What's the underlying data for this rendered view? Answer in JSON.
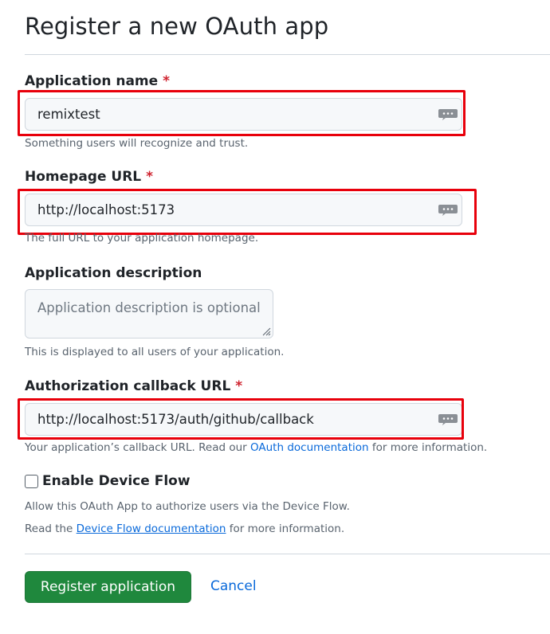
{
  "page": {
    "title": "Register a new OAuth app"
  },
  "fields": {
    "app_name": {
      "label": "Application name",
      "required_mark": "*",
      "value": "remixtest",
      "hint": "Something users will recognize and trust."
    },
    "homepage_url": {
      "label": "Homepage URL",
      "required_mark": "*",
      "value": "http://localhost:5173",
      "hint": "The full URL to your application homepage."
    },
    "description": {
      "label": "Application description",
      "placeholder": "Application description is optional",
      "hint": "This is displayed to all users of your application."
    },
    "callback_url": {
      "label": "Authorization callback URL",
      "required_mark": "*",
      "value": "http://localhost:5173/auth/github/callback",
      "hint_pre": "Your application’s callback URL. Read our ",
      "hint_link": "OAuth documentation",
      "hint_post": " for more information."
    }
  },
  "device_flow": {
    "label": "Enable Device Flow",
    "checked": false,
    "line1": "Allow this OAuth App to authorize users via the Device Flow.",
    "line2_pre": "Read the ",
    "line2_link": "Device Flow documentation",
    "line2_post": " for more information."
  },
  "actions": {
    "register_label": "Register application",
    "cancel_label": "Cancel"
  },
  "colors": {
    "primary_button": "#1f883d",
    "link": "#0969da",
    "required": "#cf222e",
    "highlight_box": "#e8000b"
  },
  "icons": {
    "input_icon": "password-manager-icon",
    "checkbox": "checkbox-unchecked-icon"
  }
}
